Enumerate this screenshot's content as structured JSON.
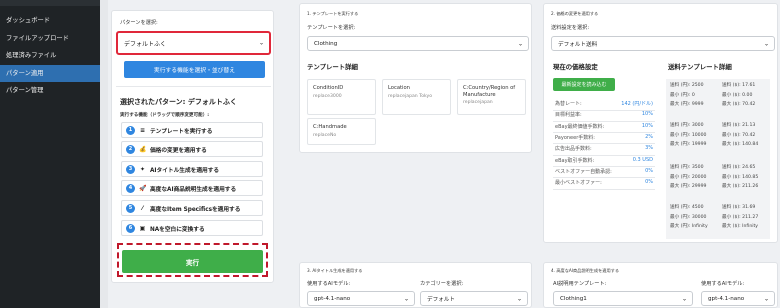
{
  "sidebar": {
    "items": [
      {
        "label": "ダッシュボード",
        "active": false
      },
      {
        "label": "ファイルアップロード",
        "active": false
      },
      {
        "label": "処理済みファイル",
        "active": false
      },
      {
        "label": "パターン適用",
        "active": true
      },
      {
        "label": "パターン管理",
        "active": false
      }
    ]
  },
  "pattern_panel": {
    "select_label": "パターンを選択:",
    "select_value": "デフォルトふく",
    "select_features_button": "実行する機能を選択・並び替え",
    "selected_title": "選択されたパターン: デフォルトふく",
    "order_hint": "実行する機能（ドラッグで順序変更可能）:",
    "steps": [
      {
        "num": "1",
        "icon": "document-icon",
        "glyph": "≡",
        "label": "テンプレートを実行する"
      },
      {
        "num": "2",
        "icon": "money-bag-icon",
        "glyph": "💰",
        "label": "価格の変更を適用する"
      },
      {
        "num": "3",
        "icon": "sparkle-icon",
        "glyph": "✦",
        "label": "AIタイトル生成を適用する"
      },
      {
        "num": "4",
        "icon": "rocket-icon",
        "glyph": "🚀",
        "label": "高度なAI商品説明生成を適用する"
      },
      {
        "num": "5",
        "icon": "magic-wand-icon",
        "glyph": "⁄",
        "label": "高度なItem Specificsを適用する"
      },
      {
        "num": "6",
        "icon": "na-icon",
        "glyph": "▣",
        "label": "NAを空白に変換する"
      }
    ],
    "run_button": "実行"
  },
  "section1": {
    "title": "1. テンプレートを実行する",
    "template_label": "テンプレートを選択:",
    "template_value": "Clothing",
    "details_title": "テンプレート詳細",
    "fields": [
      {
        "name": "ConditionID",
        "value": "replace3000"
      },
      {
        "name": "Location",
        "value": "replacejapan Tokyo"
      },
      {
        "name": "C:Country/Region of Manufacture",
        "value": "replacejapan"
      },
      {
        "name": "C:Handmade",
        "value": "replaceNo"
      }
    ]
  },
  "section2": {
    "title": "2. 価格の変更を適用する",
    "shipping_label": "送料設定を選択:",
    "shipping_value": "デフォルト送料",
    "current_title": "現在の価格設定",
    "refresh_button": "最新設定を読み込む",
    "rows": [
      {
        "k": "為替レート:",
        "v": "142 (円/ドル)"
      },
      {
        "k": "目標利益率:",
        "v": "10%"
      },
      {
        "k": "eBay最終価値手数料:",
        "v": "10%"
      },
      {
        "k": "Payoneer手数料:",
        "v": "2%"
      },
      {
        "k": "広告出品手数料:",
        "v": "3%"
      },
      {
        "k": "eBay取引手数料:",
        "v": "0.3 USD"
      },
      {
        "k": "ベストオファー自動承認:",
        "v": "0%"
      },
      {
        "k": "最小ベストオファー:",
        "v": "0%"
      }
    ],
    "shipping_title": "送料テンプレート詳細",
    "tiers": [
      {
        "l1": "送料 (円): 2500",
        "r1": "送料 ($): 17.61",
        "l2": "最小 (円): 0",
        "r2": "最小 ($): 0.00",
        "l3": "最大 (円): 9999",
        "r3": "最大 ($): 70.42"
      },
      {
        "l1": "送料 (円): 3000",
        "r1": "送料 ($): 21.13",
        "l2": "最小 (円): 10000",
        "r2": "最小 ($): 70.42",
        "l3": "最大 (円): 19999",
        "r3": "最大 ($): 140.84"
      },
      {
        "l1": "送料 (円): 3500",
        "r1": "送料 ($): 24.65",
        "l2": "最小 (円): 20000",
        "r2": "最小 ($): 140.85",
        "l3": "最大 (円): 29999",
        "r3": "最大 ($): 211.26"
      },
      {
        "l1": "送料 (円): 4500",
        "r1": "送料 ($): 31.69",
        "l2": "最小 (円): 30000",
        "r2": "最小 ($): 211.27",
        "l3": "最大 (円): Infinity",
        "r3": "最大 ($): Infinity"
      }
    ]
  },
  "section3": {
    "title": "3. AIタイトル生成を適用する",
    "model_label": "使用するAIモデル:",
    "model_value": "gpt-4.1-nano",
    "category_label": "カテゴリーを選択:",
    "category_value": "デフォルト"
  },
  "section4": {
    "title": "4. 高度なAI商品説明生成を適用する",
    "template_label": "AI説明用テンプレート:",
    "template_value": "Clothing1",
    "model_label": "使用するAIモデル:",
    "model_value": "gpt-4.1-nano"
  },
  "colors": {
    "accent": "#2f86e0",
    "run": "#3fae49",
    "highlight": "#e0283a",
    "sidebar": "#1f2326",
    "sidebar_active": "#2e6fb0"
  }
}
